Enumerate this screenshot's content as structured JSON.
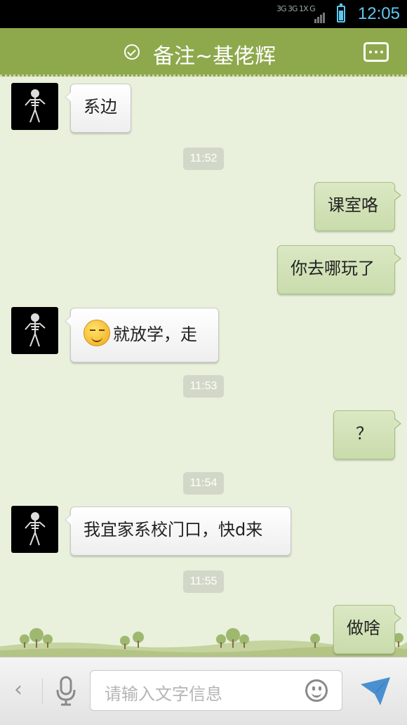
{
  "status_bar": {
    "network": "3G 3G 1X G",
    "time": "12:05"
  },
  "header": {
    "title": "备注~基佬辉"
  },
  "messages": [
    {
      "side": "in",
      "text": "系边"
    },
    {
      "type": "time",
      "text": "11:52"
    },
    {
      "side": "out",
      "text": "课室咯"
    },
    {
      "side": "out",
      "text": "你去哪玩了"
    },
    {
      "side": "in",
      "emoji": "smirk-emoji",
      "text": "就放学，走"
    },
    {
      "type": "time",
      "text": "11:53"
    },
    {
      "side": "out",
      "text": "？"
    },
    {
      "type": "time",
      "text": "11:54"
    },
    {
      "side": "in",
      "text": "我宜家系校门口，快d来"
    },
    {
      "type": "time",
      "text": "11:55"
    },
    {
      "side": "out",
      "text": "做啥"
    }
  ],
  "input_bar": {
    "placeholder": "请输入文字信息"
  },
  "colors": {
    "header": "#8ea84c",
    "chat_background": "#e9f0dc",
    "outgoing_bubble": "#d0e0b4",
    "incoming_bubble": "#f8f8f8",
    "status_accent": "#5ec8ef"
  },
  "icons": [
    "check-circle-icon",
    "more-icon",
    "back-arrow-icon",
    "microphone-icon",
    "emoji-icon",
    "send-icon"
  ]
}
